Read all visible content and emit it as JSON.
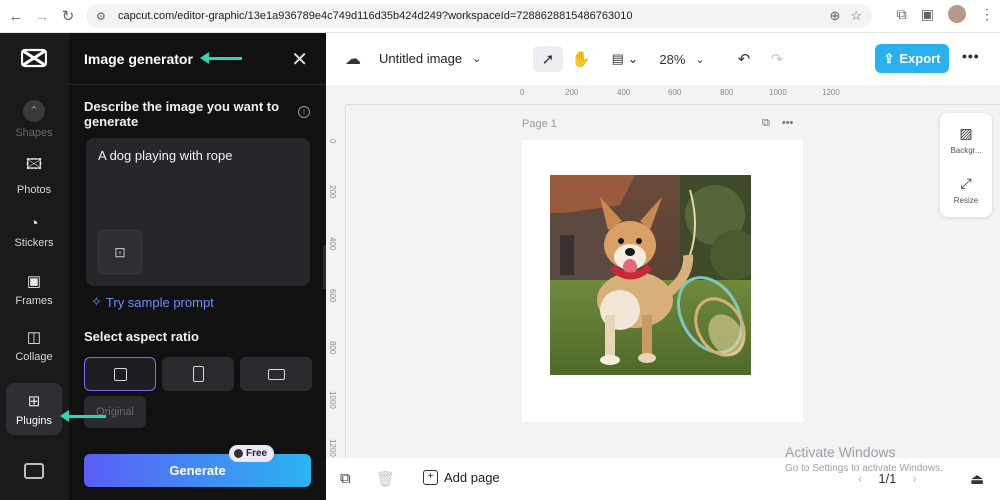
{
  "browser": {
    "url": "capcut.com/editor-graphic/13e1a936789e4c749d116d35b424d249?workspaceId=7288628815486763010"
  },
  "rail": {
    "items": [
      {
        "label": "Shapes"
      },
      {
        "label": "Photos"
      },
      {
        "label": "Stickers"
      },
      {
        "label": "Frames"
      },
      {
        "label": "Collage"
      },
      {
        "label": "Plugins"
      }
    ]
  },
  "panel": {
    "title": "Image generator",
    "describe_label": "Describe the image you want to generate",
    "prompt": "A dog playing with rope",
    "sample_prompt": "Try sample prompt",
    "aspect_label": "Select aspect ratio",
    "original_label": "Original",
    "generate_label": "Generate",
    "free_badge": "Free"
  },
  "editor": {
    "doc_title": "Untitled image",
    "zoom": "28%",
    "export_label": "Export",
    "page_label": "Page 1",
    "ruler_h_ticks": [
      "0",
      "200",
      "400",
      "600",
      "800",
      "1000",
      "1200"
    ],
    "ruler_v_ticks": [
      "0",
      "200",
      "400",
      "600",
      "800",
      "1000",
      "1200"
    ],
    "side_tools": [
      {
        "label": "Backgr..."
      },
      {
        "label": "Resize"
      }
    ],
    "add_page_label": "Add page",
    "pager": "1/1"
  },
  "overlay": {
    "activate_title": "Activate Windows",
    "activate_sub": "Go to Settings to activate Windows."
  },
  "colors": {
    "accent": "#2ab0ef",
    "annotation_arrow": "#2fd6b5",
    "selected_ratio_border": "#7c6cf0",
    "link": "#6b8dff"
  }
}
